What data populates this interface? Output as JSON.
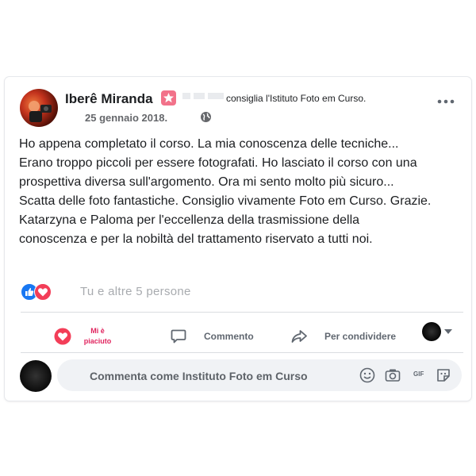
{
  "post": {
    "author": "Iberê Miranda",
    "action_text": "consiglia l'Istituto Foto em Curso.",
    "date": "25 gennaio 2018.",
    "body_lines": [
      "Ho appena completato il corso. La mia conoscenza delle tecniche...",
      "Erano troppo piccoli per essere fotografati. Ho lasciato il corso con una",
      "prospettiva diversa sull'argomento. Ora mi sento molto più sicuro...",
      "Scatta delle foto fantastiche. Consiglio vivamente Foto em Curso. Grazie.",
      "Katarzyna e Paloma per l'eccellenza della trasmissione della",
      "conoscenza e per la nobiltà del trattamento riservato a tutti noi."
    ]
  },
  "reactions": {
    "summary": "Tu e altre 5 persone"
  },
  "actions": {
    "like_label": "Mi è piaciuto",
    "comment_label": "Commento",
    "share_label": "Per condividere"
  },
  "composer": {
    "placeholder": "Commenta come Instituto Foto em Curso",
    "gif_label": "GIF"
  },
  "colors": {
    "like_blue": "#1877f2",
    "love_red": "#f33e58",
    "liked_pink": "#e0245e",
    "badge_pink": "#f2728a"
  }
}
